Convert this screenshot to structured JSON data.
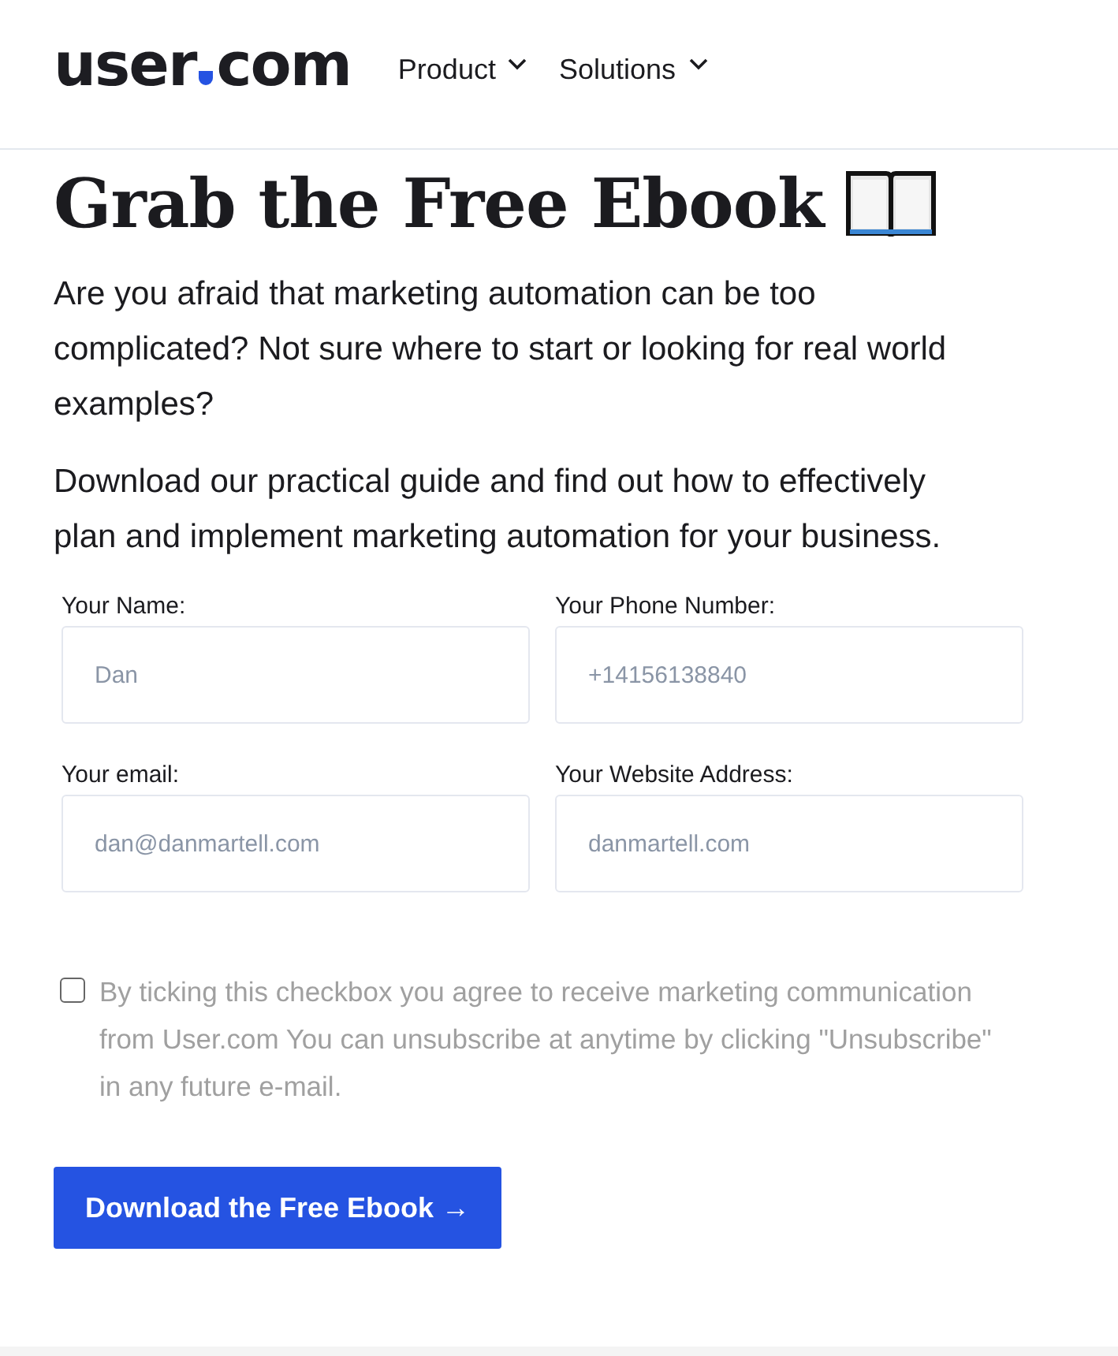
{
  "header": {
    "logo": {
      "left": "user",
      "right": "com"
    },
    "nav": [
      {
        "label": "Product",
        "expanded": false
      },
      {
        "label": "Solutions",
        "expanded": false
      }
    ]
  },
  "title": "Grab the Free Ebook",
  "paragraphs": [
    "Are you afraid that marketing automation can be too complicated? Not sure where to start or looking for real world examples?",
    "Download our practical guide and find out how to effectively plan and implement marketing automation for your business."
  ],
  "fields": [
    {
      "label": "Your Name:",
      "placeholder": "Dan"
    },
    {
      "label": "Your Phone Number:",
      "placeholder": "+14156138840"
    },
    {
      "label": "Your email:",
      "placeholder": "dan@danmartell.com"
    },
    {
      "label": "Your Website Address:",
      "placeholder": "danmartell.com"
    }
  ],
  "consent": {
    "checked": false,
    "text": "By ticking this checkbox you agree to receive marketing communication from User.com You can unsubscribe at anytime by clicking \"Unsubscribe\" in any future e-mail."
  },
  "submit": "Download the Free Ebook →"
}
